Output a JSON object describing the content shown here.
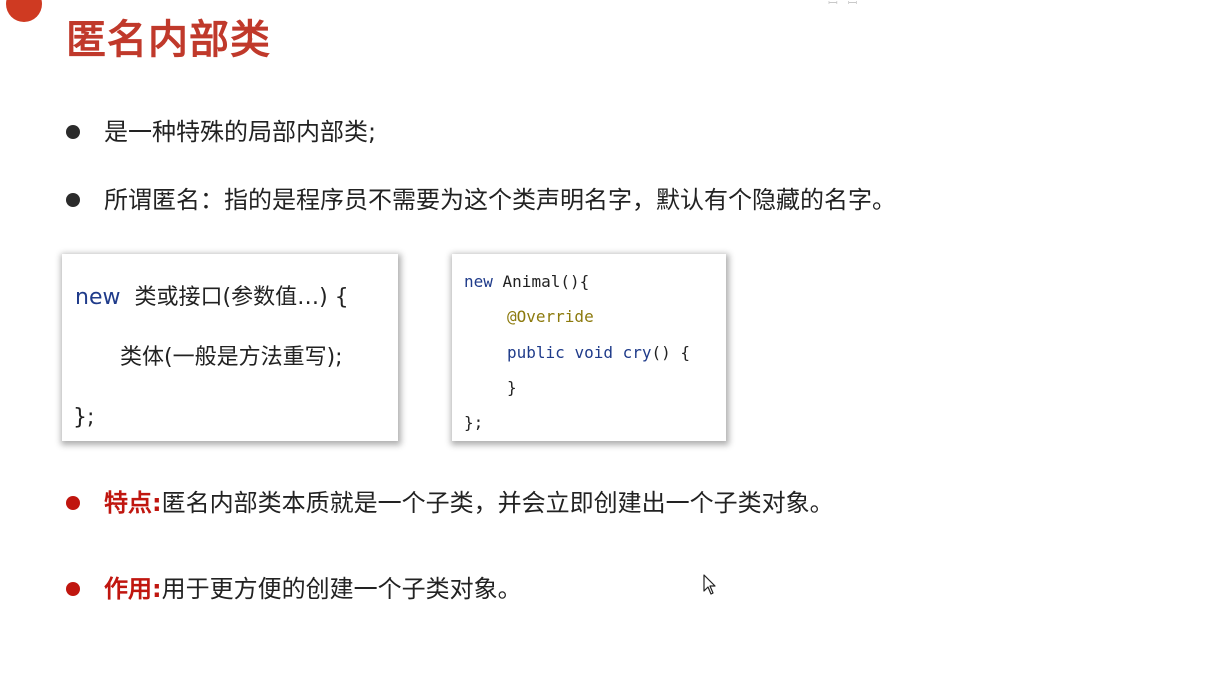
{
  "title": "匿名内部类",
  "bullets": [
    {
      "text": "是一种特殊的局部内部类;"
    },
    {
      "text": "所谓匿名：指的是程序员不需要为这个类声明名字，默认有个隐藏的名字。"
    }
  ],
  "syntax_box": {
    "line1_keyword": "new",
    "line1_rest": "类或接口(参数值…) {",
    "line2": "类体(一般是方法重写);",
    "line3": "};"
  },
  "example_code": {
    "line1_keyword": "new",
    "line1_rest": " Animal(){",
    "line2_annotation": "@Override",
    "line3_kw1": "public",
    "line3_kw2": "void",
    "line3_method": "cry",
    "line3_rest": "() {",
    "line4": "}",
    "line5": "};"
  },
  "features": {
    "label": "特点:",
    "text": "匿名内部类本质就是一个子类，并会立即创建出一个子类对象。"
  },
  "usage": {
    "label": "作用:",
    "text": "用于更方便的创建一个子类对象。"
  },
  "colors": {
    "title": "#c0392b",
    "accent_red": "#c0160f",
    "code_keyword": "#1f3b8a",
    "code_annotation": "#8c7a0d"
  },
  "icons": {
    "cursor": "mouse-pointer-icon"
  }
}
